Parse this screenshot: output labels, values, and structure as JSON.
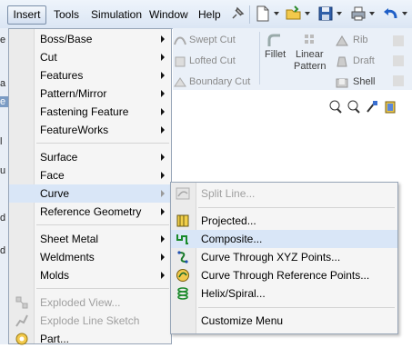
{
  "menubar": {
    "items": [
      "Insert",
      "Tools",
      "Simulation",
      "Window",
      "Help"
    ]
  },
  "ribbon": {
    "swept_cut": "Swept Cut",
    "lofted_cut": "Lofted Cut",
    "boundary_cut": "Boundary Cut",
    "fillet": "Fillet",
    "linear_pattern_1": "Linear",
    "linear_pattern_2": "Pattern",
    "rib": "Rib",
    "draft": "Draft",
    "shell": "Shell"
  },
  "left_panel": {
    "bits": [
      "e",
      "a",
      "e",
      "l",
      "u",
      "d",
      "d"
    ]
  },
  "insert_menu": {
    "items": [
      {
        "label": "Boss/Base",
        "submenu": true
      },
      {
        "label": "Cut",
        "submenu": true
      },
      {
        "label": "Features",
        "submenu": true
      },
      {
        "label": "Pattern/Mirror",
        "submenu": true
      },
      {
        "label": "Fastening Feature",
        "submenu": true
      },
      {
        "label": "FeatureWorks",
        "submenu": true
      },
      {
        "label": "Surface",
        "submenu": true
      },
      {
        "label": "Face",
        "submenu": true
      },
      {
        "label": "Curve",
        "submenu": true,
        "highlighted": true
      },
      {
        "label": "Reference Geometry",
        "submenu": true
      },
      {
        "label": "Sheet Metal",
        "submenu": true
      },
      {
        "label": "Weldments",
        "submenu": true
      },
      {
        "label": "Molds",
        "submenu": true
      },
      {
        "label": "Exploded View...",
        "disabled": true
      },
      {
        "label": "Explode Line Sketch",
        "disabled": true
      },
      {
        "label": "Part..."
      }
    ]
  },
  "curve_submenu": {
    "items": [
      {
        "label": "Split Line...",
        "disabled": true
      },
      {
        "label": "Projected..."
      },
      {
        "label": "Composite...",
        "highlighted": true
      },
      {
        "label": "Curve Through XYZ Points..."
      },
      {
        "label": "Curve Through Reference Points..."
      },
      {
        "label": "Helix/Spiral..."
      },
      {
        "label": "Customize Menu"
      }
    ]
  },
  "colors": {
    "highlight": "#d9e6f7",
    "menu_bg": "#f5f5f5",
    "disabled_text": "#a0a0a0"
  }
}
